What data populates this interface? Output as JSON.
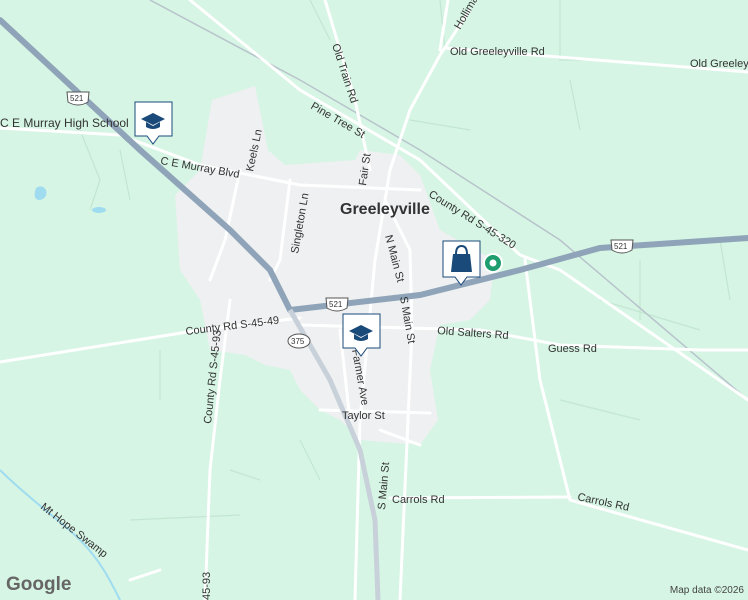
{
  "town_label": "Greeleyville",
  "roads": {
    "holliman": "Holliman Rd",
    "old_greeleyville": "Old Greeleyville Rd",
    "old_greeleyville_right": "Old Greeley",
    "old_train": "Old Train Rd",
    "pine_tree": "Pine Tree St",
    "ce_murray": "C E Murray Blvd",
    "keels": "Keels Ln",
    "fair": "Fair St",
    "county_320": "County Rd S-45-320",
    "singleton": "Singleton Ln",
    "n_main": "N Main St",
    "s_main_upper": "S Main St",
    "county_49": "County Rd S-45-49",
    "old_salters": "Old Salters Rd",
    "guess": "Guess Rd",
    "county_93": "County Rd S-45-93",
    "county_93_bottom": "45-93",
    "farmer": "Farmer Ave",
    "taylor": "Taylor St",
    "s_main_lower": "S Main St",
    "carrols_left": "Carrols Rd",
    "carrols_right": "Carrols Rd",
    "swamp": "Mt Hope Swamp"
  },
  "shields": {
    "us521_top": "521",
    "us521_mid": "521",
    "us521_right": "521",
    "sc375": "375"
  },
  "pois": {
    "high_school": "C E Murray High School",
    "school_icon": "graduation-cap-icon",
    "shop_icon": "shopping-bag-icon"
  },
  "footer": {
    "logo": "Google",
    "attribution": "Map data ©2026"
  },
  "colors": {
    "land": "#d6f5e4",
    "town_area": "#eef0f1",
    "highway": "#8fa4b8",
    "road": "#ffffff",
    "water": "#9fdcf0",
    "poi_blue": "#1a4a7a",
    "marker_green": "#1e9e6e"
  }
}
